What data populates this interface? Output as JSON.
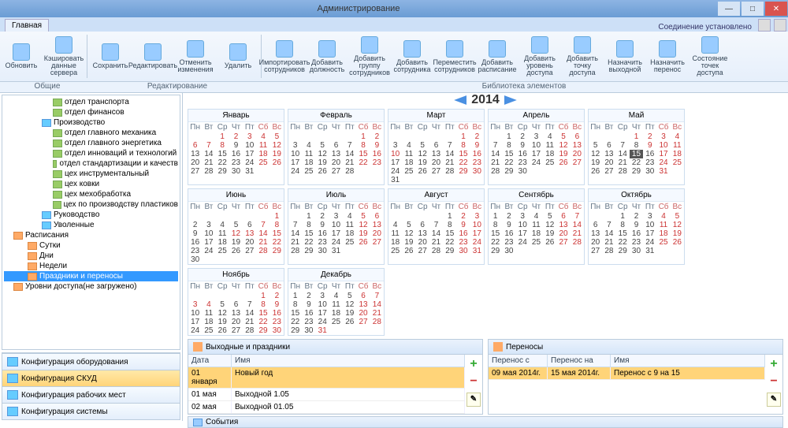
{
  "window": {
    "title": "Администрирование"
  },
  "tabs": {
    "main": "Главная",
    "status": "Соединение установлено"
  },
  "ribbon": {
    "btns": [
      {
        "label": "Обновить"
      },
      {
        "label": "Кэшировать данные сервера"
      },
      {
        "label": "Сохранить"
      },
      {
        "label": "Редактировать"
      },
      {
        "label": "Отменить изменения"
      },
      {
        "label": "Удалить"
      },
      {
        "label": "Импортировать сотрудников"
      },
      {
        "label": "Добавить должность"
      },
      {
        "label": "Добавить группу сотрудников"
      },
      {
        "label": "Добавить сотрудника"
      },
      {
        "label": "Переместить сотрудников"
      },
      {
        "label": "Добавить расписание"
      },
      {
        "label": "Добавить уровень доступа"
      },
      {
        "label": "Добавить точку доступа"
      },
      {
        "label": "Назначить выходной"
      },
      {
        "label": "Назначить перенос"
      },
      {
        "label": "Состояние точек доступа"
      }
    ],
    "groups": {
      "g1": "Общие",
      "g2": "Редактирование",
      "g3": "Библиотека элементов"
    }
  },
  "tree": {
    "items": [
      {
        "l": 4,
        "text": "отдел транспорта",
        "icon": "green"
      },
      {
        "l": 4,
        "text": "отдел финансов",
        "icon": "green"
      },
      {
        "l": 3,
        "text": "Производство",
        "icon": "blue"
      },
      {
        "l": 4,
        "text": "отдел главного механика",
        "icon": "green"
      },
      {
        "l": 4,
        "text": "отдел главного энергетика",
        "icon": "green"
      },
      {
        "l": 4,
        "text": "отдел инноваций и технологий",
        "icon": "green"
      },
      {
        "l": 4,
        "text": "отдел стандартизации и качеств",
        "icon": "green"
      },
      {
        "l": 4,
        "text": "цех инструментальный",
        "icon": "green"
      },
      {
        "l": 4,
        "text": "цех ковки",
        "icon": "green"
      },
      {
        "l": 4,
        "text": "цех мехобработка",
        "icon": "green"
      },
      {
        "l": 4,
        "text": "цех по производству пластиков",
        "icon": "green"
      },
      {
        "l": 3,
        "text": "Руководство",
        "icon": "blue"
      },
      {
        "l": 3,
        "text": "Уволенные",
        "icon": "blue"
      },
      {
        "l": 1,
        "text": "Расписания",
        "icon": "or"
      },
      {
        "l": 2,
        "text": "Сутки",
        "icon": "or"
      },
      {
        "l": 2,
        "text": "Дни",
        "icon": "or"
      },
      {
        "l": 2,
        "text": "Недели",
        "icon": "or"
      },
      {
        "l": 2,
        "text": "Праздники и переносы",
        "icon": "or",
        "sel": true
      },
      {
        "l": 1,
        "text": "Уровни доступа(не загружено)",
        "icon": "or"
      }
    ]
  },
  "accordion": [
    {
      "text": "Конфигурация оборудования",
      "sel": false
    },
    {
      "text": "Конфигурация СКУД",
      "sel": true
    },
    {
      "text": "Конфигурация рабочих мест",
      "sel": false
    },
    {
      "text": "Конфигурация системы",
      "sel": false
    }
  ],
  "year": "2014",
  "months": [
    "Январь",
    "Февраль",
    "Март",
    "Апрель",
    "Май",
    "Июнь",
    "Июль",
    "Август",
    "Сентябрь",
    "Октябрь",
    "Ноябрь",
    "Декабрь"
  ],
  "dow": [
    "Пн",
    "Вт",
    "Ср",
    "Чт",
    "Пт",
    "Сб",
    "Вс"
  ],
  "month_start_dow": [
    2,
    5,
    5,
    1,
    3,
    6,
    1,
    4,
    0,
    2,
    5,
    0
  ],
  "month_days": [
    31,
    28,
    31,
    30,
    31,
    30,
    31,
    31,
    30,
    31,
    30,
    31
  ],
  "holidays": {
    "1": [
      1,
      2,
      3,
      4,
      5,
      6,
      7,
      8
    ],
    "2": [
      23
    ],
    "3": [
      8,
      10
    ],
    "5": [
      1,
      2,
      3,
      4,
      9,
      10,
      11
    ],
    "6": [
      12,
      13
    ],
    "11": [
      3,
      4
    ],
    "12": [
      31
    ]
  },
  "selected_day": {
    "month": 5,
    "day": 15
  },
  "panels": {
    "holidays": {
      "title": "Выходные и праздники",
      "cols": {
        "date": "Дата",
        "name": "Имя"
      },
      "rows": [
        {
          "date": "01 января",
          "name": "Новый год",
          "sel": true
        },
        {
          "date": "01 мая",
          "name": "Выходной 1.05",
          "sel": false
        },
        {
          "date": "02 мая",
          "name": "Выходной 01.05",
          "sel": false
        }
      ]
    },
    "transfers": {
      "title": "Переносы",
      "cols": {
        "from": "Перенос с",
        "to": "Перенос на",
        "name": "Имя"
      },
      "rows": [
        {
          "from": "09 мая 2014г.",
          "to": "15 мая 2014г.",
          "name": "Перенос с 9 на 15",
          "sel": true
        }
      ]
    }
  },
  "events": {
    "title": "События"
  }
}
